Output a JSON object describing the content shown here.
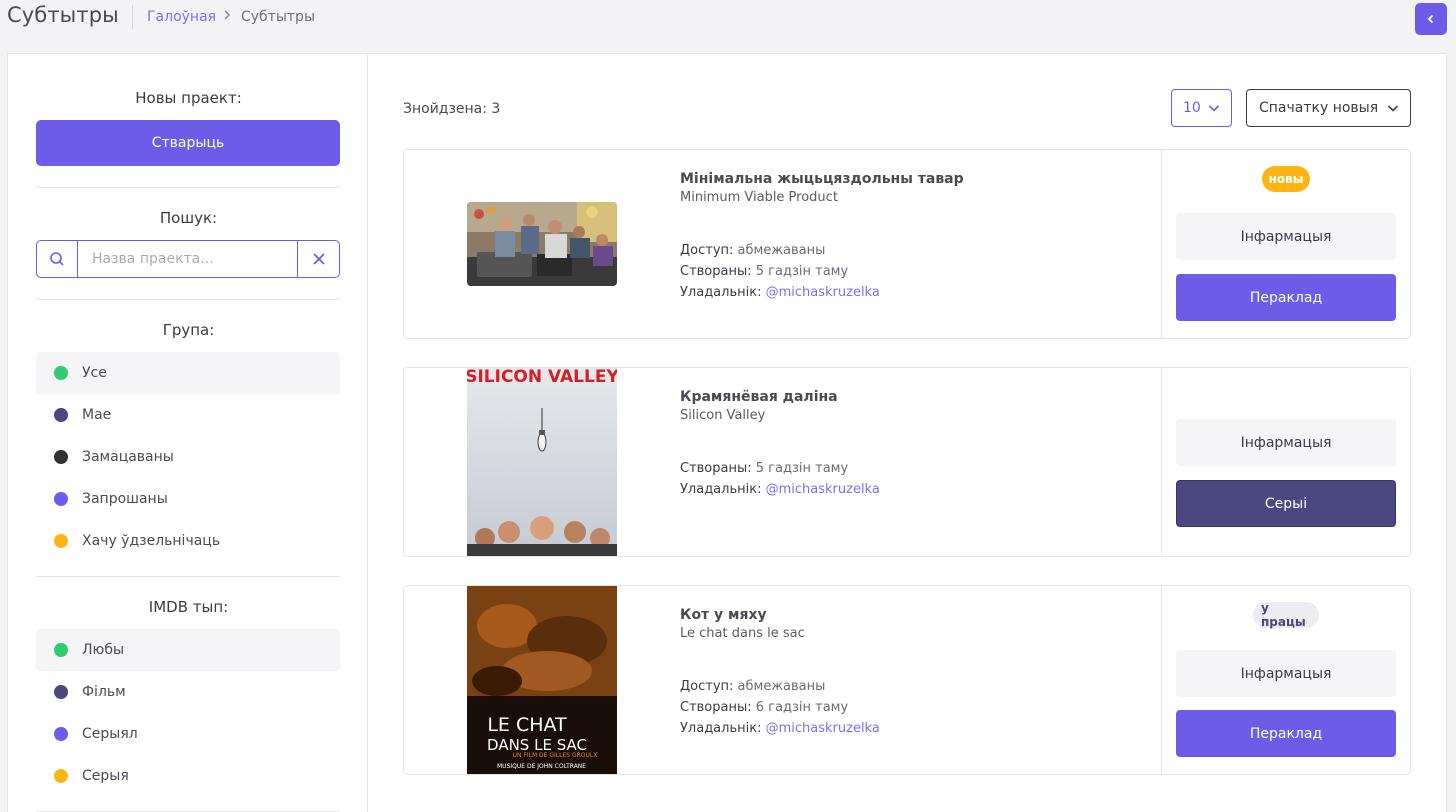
{
  "header": {
    "title": "Субтытры",
    "breadcrumb_home": "Галоўная",
    "breadcrumb_current": "Субтытры",
    "back_icon": "chevron-left-icon"
  },
  "sidebar": {
    "new_project_label": "Новы праект:",
    "create_button": "Стварыць",
    "search_label": "Пошук:",
    "search_placeholder": "Назва праекта...",
    "search_value": "",
    "group_label": "Група:",
    "groups": [
      {
        "label": "Усе",
        "color": "#2ecc71",
        "active": true
      },
      {
        "label": "Мае",
        "color": "#4b4780",
        "active": false
      },
      {
        "label": "Замацаваны",
        "color": "#333333",
        "active": false
      },
      {
        "label": "Запрошаны",
        "color": "#6c5ce7",
        "active": false
      },
      {
        "label": "Хачу ўдзельнічаць",
        "color": "#fdb515",
        "active": false
      }
    ],
    "imdb_label": "IMDB тып:",
    "imdb_types": [
      {
        "label": "Любы",
        "color": "#2ecc71",
        "active": true
      },
      {
        "label": "Фільм",
        "color": "#4b4780",
        "active": false
      },
      {
        "label": "Серыял",
        "color": "#6c5ce7",
        "active": false
      },
      {
        "label": "Серыя",
        "color": "#fdb515",
        "active": false
      }
    ]
  },
  "main": {
    "found_text": "Знойдзена: 3",
    "per_page": "10",
    "sort": "Спачатку новыя",
    "cards": [
      {
        "title": "Мінімальна жыцьцяздольны тавар",
        "original_title": "Minimum Viable Product",
        "access_label": "Доступ:",
        "access_value": "абмежаваны",
        "created_label": "Створаны:",
        "created_value": "5 гадзін таму",
        "owner_label": "Уладальнік:",
        "owner_value": "@michaskruzelka",
        "badge": "новы",
        "info_button": "Інфармацыя",
        "action_button": "Пераклад"
      },
      {
        "title": "Крамянёвая даліна",
        "original_title": "Silicon Valley",
        "created_label": "Створаны:",
        "created_value": "5 гадзін таму",
        "owner_label": "Уладальнік:",
        "owner_value": "@michaskruzelka",
        "poster_text": "SILICON VALLEY",
        "info_button": "Інфармацыя",
        "action_button": "Серыі"
      },
      {
        "title": "Кот у мяху",
        "original_title": "Le chat dans le sac",
        "access_label": "Доступ:",
        "access_value": "абмежаваны",
        "created_label": "Створаны:",
        "created_value": "6 гадзін таму",
        "owner_label": "Уладальнік:",
        "owner_value": "@michaskruzelka",
        "badge": "у працы",
        "poster_text_1": "LE CHAT",
        "poster_text_2": "DANS LE SAC",
        "poster_text_3": "UN FILM DE GILLES GROULX",
        "poster_text_4": "MUSIQUE DE JOHN COLTRANE",
        "info_button": "Інфармацыя",
        "action_button": "Пераклад"
      }
    ]
  }
}
